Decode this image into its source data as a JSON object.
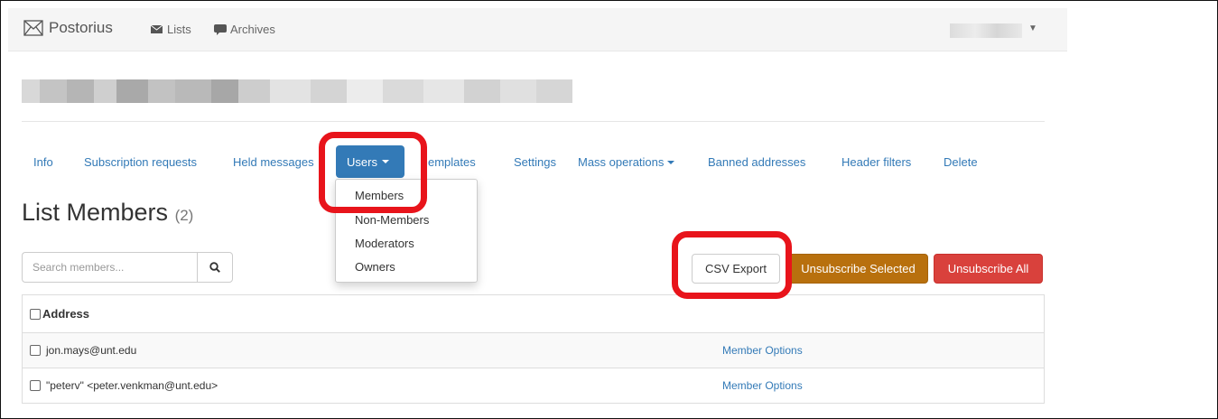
{
  "navbar": {
    "brand": "Postorius",
    "lists_label": "Lists",
    "archives_label": "Archives"
  },
  "tabs": {
    "info": "Info",
    "subscription_requests": "Subscription requests",
    "held_messages": "Held messages",
    "users": "Users",
    "templates": "emplates",
    "settings": "Settings",
    "mass_operations": "Mass operations",
    "banned_addresses": "Banned addresses",
    "header_filters": "Header filters",
    "delete": "Delete"
  },
  "users_menu": [
    "Members",
    "Non-Members",
    "Moderators",
    "Owners"
  ],
  "page": {
    "title": "List Members",
    "count": "(2)"
  },
  "search": {
    "placeholder": "Search members..."
  },
  "buttons": {
    "csv_export": "CSV Export",
    "unsubscribe_selected": "Unsubscribe Selected",
    "unsubscribe_all": "Unsubscribe All"
  },
  "table": {
    "header": "Address",
    "rows": [
      {
        "address": "jon.mays@unt.edu",
        "action": "Member Options"
      },
      {
        "address": "\"peterv\" <peter.venkman@unt.edu>",
        "action": "Member Options"
      }
    ]
  },
  "colors": {
    "primary": "#337ab7",
    "warning": "#b8700e",
    "danger": "#d9413c",
    "annotation": "#e8141b"
  }
}
